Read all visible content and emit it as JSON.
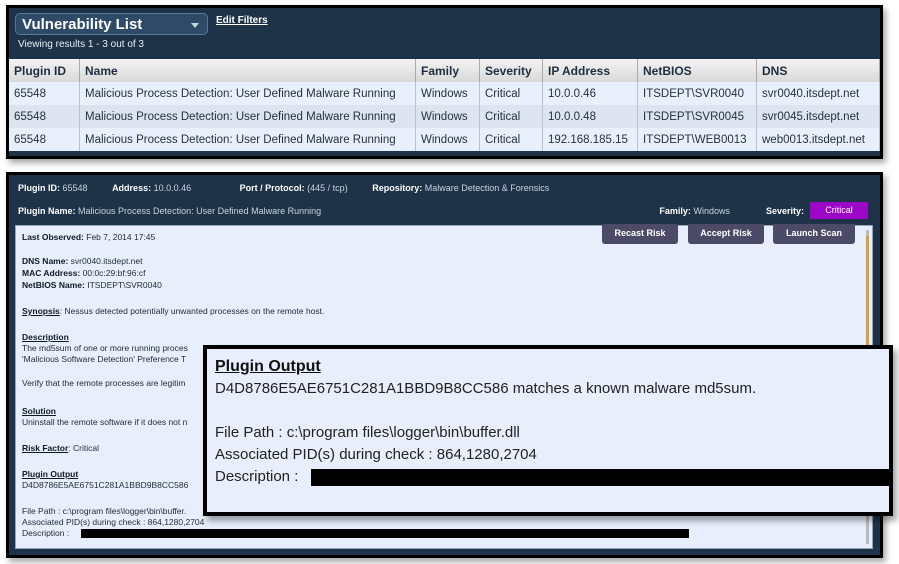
{
  "vuln_list": {
    "title": "Vulnerability List",
    "edit_filters": "Edit Filters",
    "viewing": "Viewing results 1 - 3 out of 3",
    "columns": [
      "Plugin ID",
      "Name",
      "Family",
      "Severity",
      "IP Address",
      "NetBIOS",
      "DNS"
    ],
    "rows": [
      [
        "65548",
        "Malicious Process Detection: User Defined Malware Running",
        "Windows",
        "Critical",
        "10.0.0.46",
        "ITSDEPT\\SVR0040",
        "svr0040.itsdept.net"
      ],
      [
        "65548",
        "Malicious Process Detection: User Defined Malware Running",
        "Windows",
        "Critical",
        "10.0.0.48",
        "ITSDEPT\\SVR0045",
        "svr0045.itsdept.net"
      ],
      [
        "65548",
        "Malicious Process Detection: User Defined Malware Running",
        "Windows",
        "Critical",
        "192.168.185.15",
        "ITSDEPT\\WEB0013",
        "web0013.itsdept.net"
      ]
    ]
  },
  "detail": {
    "plugin_id_label": "Plugin ID:",
    "plugin_id": "65548",
    "address_label": "Address:",
    "address": "10.0.0.46",
    "port_label": "Port / Protocol:",
    "port": "(445 / tcp)",
    "repository_label": "Repository:",
    "repository": "Malware Detection & Forensics",
    "plugin_name_label": "Plugin Name:",
    "plugin_name": "Malicious Process Detection: User Defined Malware Running",
    "family_label": "Family:",
    "family": "Windows",
    "severity_label": "Severity:",
    "severity": "Critical",
    "buttons": [
      "Recast Risk",
      "Accept Risk",
      "Launch Scan"
    ],
    "last_observed_label": "Last Observed:",
    "last_observed": "Feb 7, 2014 17:45",
    "dns_label": "DNS Name:",
    "dns": "svr0040.itsdept.net",
    "mac_label": "MAC Address:",
    "mac": "00:0c:29:bf:96:cf",
    "netbios_label": "NetBIOS Name:",
    "netbios": "ITSDEPT\\SVR0040",
    "synopsis_label": "Synopsis",
    "synopsis": ": Nessus detected potentially unwanted processes on the remote host.",
    "description_label": "Description",
    "description_1": "The md5sum of one or more running proces",
    "description_2": "'Malicious Software Detection' Preference T",
    "description_3": "Verify that the remote processes are legitim",
    "solution_label": "Solution",
    "solution": "Uninstall the remote software if it does not n",
    "risk_label": "Risk Factor",
    "risk": ": Critical",
    "output_label": "Plugin Output",
    "output_hash": "D4D8786E5AE6751C281A1BBD9B8CC586",
    "file_path": "File Path : c:\\program files\\logger\\bin\\buffer.",
    "pids": "Associated PID(s) during check : 864,1280,2704",
    "desc_line": "Description :"
  },
  "callout": {
    "title": "Plugin Output",
    "line1": "D4D8786E5AE6751C281A1BBD9B8CC586 matches a known malware md5sum.",
    "line2": "File Path : c:\\program files\\logger\\bin\\buffer.dll",
    "line3": "Associated PID(s) during check : 864,1280,2704",
    "line4": "Description :"
  },
  "colors": {
    "panel_bg": "#1e3348",
    "severity_critical": "#9b06c7",
    "critical_text": "#a43ccf",
    "scroll_thumb": "#d9a136"
  }
}
